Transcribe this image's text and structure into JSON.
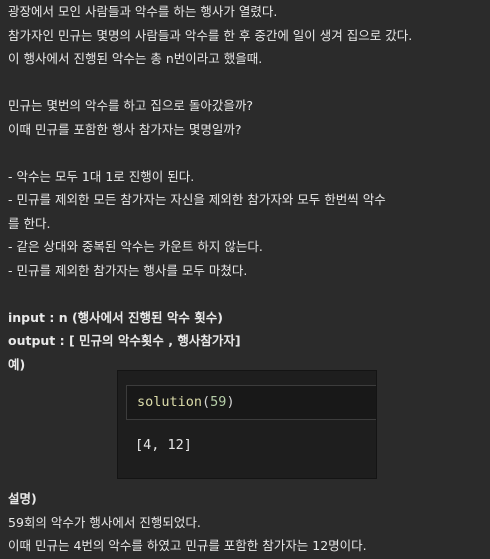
{
  "paragraph1": [
    "광장에서 모인 사람들과 악수를 하는 행사가 열렸다.",
    "참가자인 민규는 몇명의 사람들과 악수를 한 후 중간에 일이 생겨 집으로 갔다.",
    "이 행사에서 진행된 악수는 총 n번이라고 했을때."
  ],
  "paragraph2": [
    "민규는 몇번의 악수를 하고 집으로 돌아갔을까?",
    "이때 민규를 포함한 행사 참가자는 몇명일까?"
  ],
  "rules": [
    "- 악수는 모두 1대 1로 진행이 된다.",
    "- 민규를 제외한 모든 참가자는 자신을 제외한 참가자와 모두 한번씩 악수",
    "를 한다.",
    "- 같은 상대와 중복된 악수는 카운트 하지 않는다.",
    "- 민규를 제외한 참가자는 행사를 모두 마쳤다."
  ],
  "io": {
    "input": "input : n (행사에서 진행된 악수 횟수)",
    "output": "output : [ 민규의 악수횟수 , 행사참가자]",
    "example_label": "예)"
  },
  "code_example": {
    "function_name": "solution",
    "open_paren": "(",
    "argument": "59",
    "close_paren": ")",
    "result": "[4, 12]"
  },
  "explanation": {
    "label": "설명)",
    "lines": [
      "59회의 악수가 행사에서 진행되었다.",
      "이때 민규는 4번의 악수를 하였고 민규를 포함한 참가자는 12명이다."
    ]
  }
}
